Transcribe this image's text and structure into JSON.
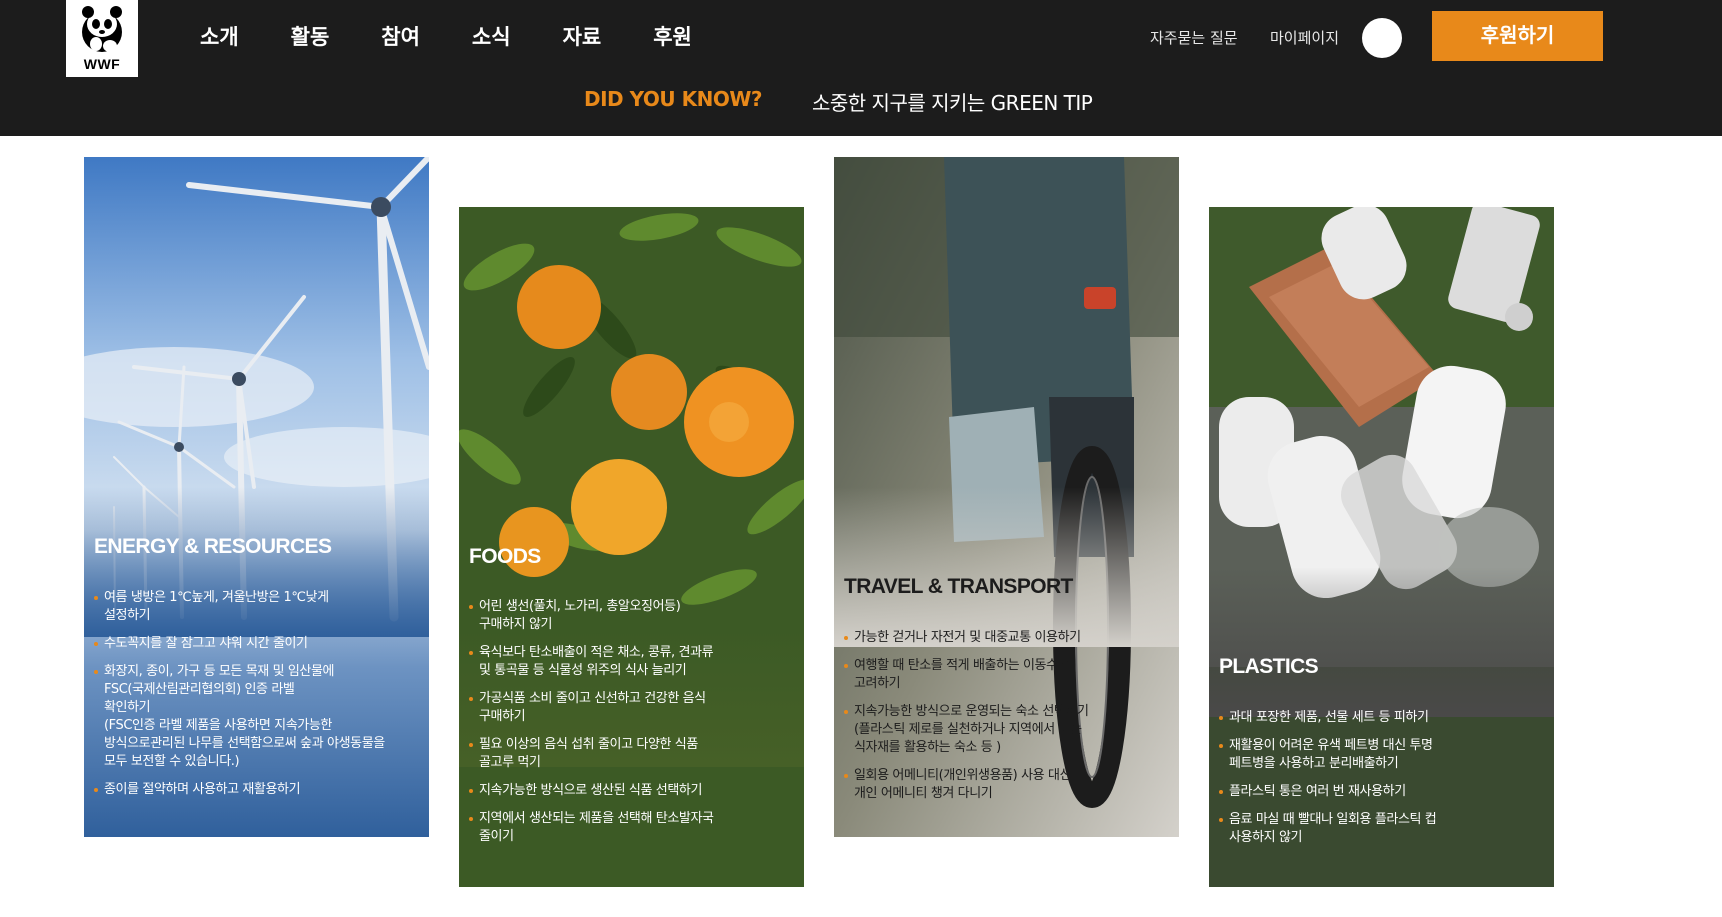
{
  "header": {
    "logo": {
      "text": "WWF",
      "icon": "panda-icon"
    },
    "nav": [
      "소개",
      "활동",
      "참여",
      "소식",
      "자료",
      "후원"
    ],
    "utility": {
      "faq": "자주묻는 질문",
      "mypage": "마이페이지"
    },
    "donate_label": "후원하기",
    "subnav": {
      "highlight": "DID YOU KNOW?",
      "tip": "소중한 지구를 지키는 GREEN TIP"
    },
    "colors": {
      "bar": "#1c1c1c",
      "accent": "#e8891a"
    }
  },
  "cards": [
    {
      "title": "ENERGY & RESOURCES",
      "image": "wind-turbines-photo",
      "items": [
        "여름 냉방은 1℃높게, 겨울난방은 1℃낮게\n설정하기",
        "수도꼭지를 잘 잠그고 샤워 시간 줄이기",
        "화장지, 종이, 가구 등 모든 목재 및 임산물에\nFSC(국제산림관리협의회) 인증 라벨\n확인하기\n(FSC인증 라벨 제품을 사용하면 지속가능한\n방식으로관리된 나무를 선택함으로써 숲과 야생동물을\n모두 보전할 수 있습니다.)",
        "종이를 절약하며 사용하고 재활용하기"
      ]
    },
    {
      "title": "FOODS",
      "image": "oranges-on-tree-photo",
      "items": [
        "어린 생선(풀치, 노가리, 총알오징어등)\n구매하지 않기",
        "육식보다 탄소배출이 적은 채소, 콩류, 견과류\n및 통곡물 등 식물성 위주의 식사 늘리기",
        "가공식품 소비 줄이고 신선하고 건강한 음식\n구매하기",
        "필요 이상의 음식 섭취 줄이고 다양한 식품\n골고루 먹기",
        "지속가능한 방식으로 생산된 식품 선택하기",
        "지역에서 생산되는 제품을 선택해 탄소발자국\n줄이기"
      ]
    },
    {
      "title": "TRAVEL & TRANSPORT",
      "image": "bicycle-photo",
      "items": [
        "가능한 걷거나 자전거 및 대중교통 이용하기",
        "여행할 때 탄소를 적게 배출하는 이동수단\n고려하기",
        "지속가능한 방식으로 운영되는 숙소 선택하기\n(플라스틱 제로를 실천하거나 지역에서 나는\n식자재를 활용하는 숙소 등 )",
        "일회용 어메니티(개인위생용품) 사용 대신\n개인 어메니티 챙겨 다니기"
      ]
    },
    {
      "title": "PLASTICS",
      "image": "plastic-waste-photo",
      "items": [
        "과대 포장한 제품, 선물 세트 등 피하기",
        "재활용이 어려운 유색 페트병 대신 투명\n페트병을 사용하고 분리배출하기",
        "플라스틱 통은 여러 번 재사용하기",
        "음료 마실 때 빨대나 일회용 플라스틱 컵\n사용하지 않기"
      ]
    }
  ]
}
